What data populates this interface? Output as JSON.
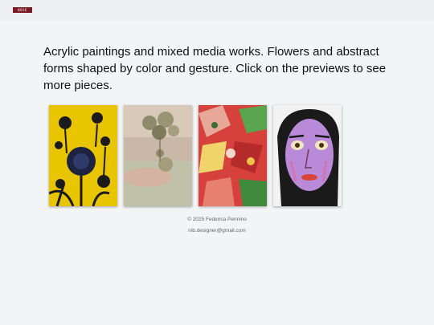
{
  "header": {
    "logo_text": "NOSE",
    "logo_color": "#7a1b24"
  },
  "intro": {
    "text": "Acrylic paintings and mixed media works. Flowers and abstract forms shaped by color and gesture. Click on the previews to see more pieces."
  },
  "gallery": {
    "items": [
      {
        "name": "dark-flowers-on-yellow-painting",
        "palette": [
          "#e9c400",
          "#1d2340"
        ]
      },
      {
        "name": "mixed-media-flowers-painting",
        "palette": [
          "#d9c7b4",
          "#8c8a6c"
        ]
      },
      {
        "name": "red-abstract-painting",
        "palette": [
          "#d6413b",
          "#e7a89a"
        ]
      },
      {
        "name": "face-portrait-painting",
        "palette": [
          "#b88ad8",
          "#1a1a1a"
        ]
      }
    ]
  },
  "footer": {
    "copyright": "© 2025 Federica Pennino",
    "email": "nib.designer@gmail.com"
  }
}
